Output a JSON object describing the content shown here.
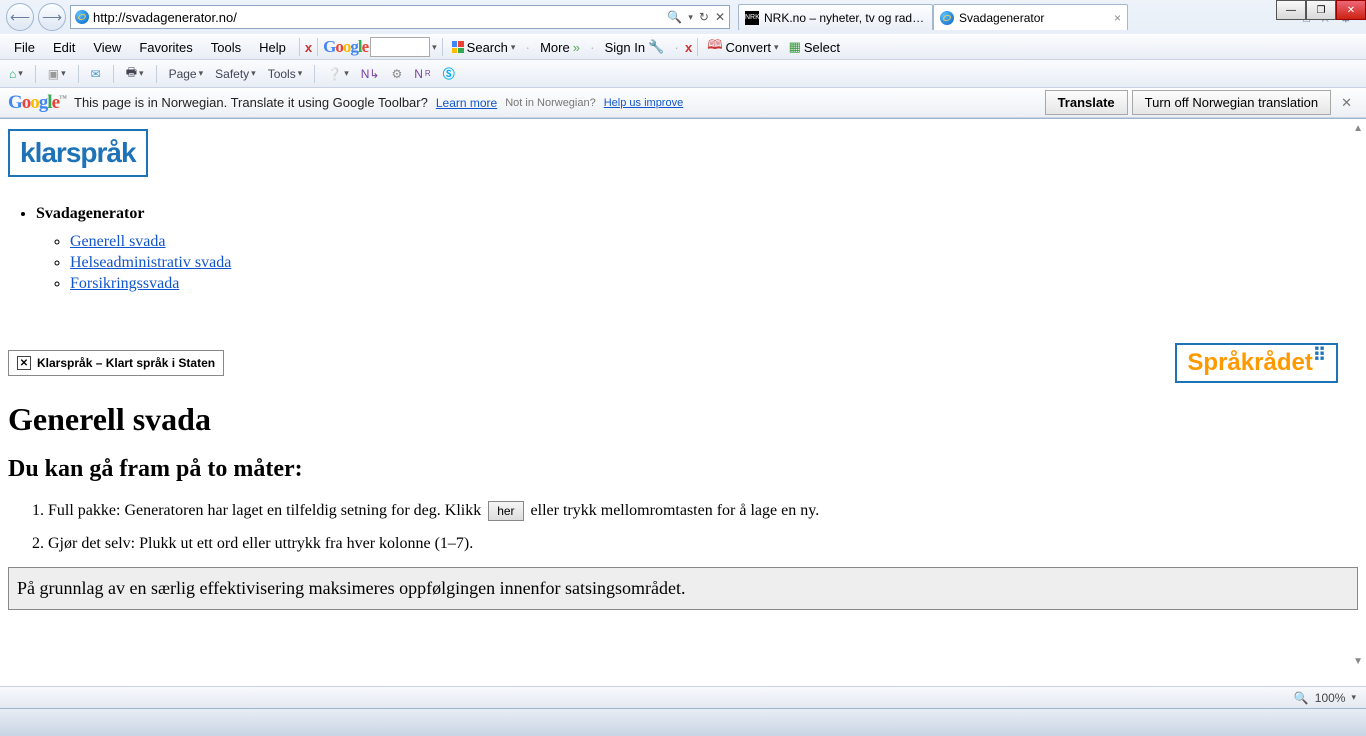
{
  "window_controls": {
    "min": "—",
    "max": "❐",
    "close": "✕"
  },
  "address_bar": {
    "url": "http://svadagenerator.no/"
  },
  "tabs": [
    {
      "title": "NRK.no – nyheter, tv og radio ...",
      "active": false
    },
    {
      "title": "Svadagenerator",
      "active": true
    }
  ],
  "chrome_icons": {
    "home": "⌂",
    "star": "☆",
    "gear": "⚙"
  },
  "menu": {
    "items": [
      "File",
      "Edit",
      "View",
      "Favorites",
      "Tools",
      "Help"
    ],
    "close_x": "x",
    "google": "Google",
    "search": "Search",
    "more": "More",
    "signin": "Sign In",
    "convert": "Convert",
    "select": "Select"
  },
  "cmdbar": {
    "page": "Page",
    "safety": "Safety",
    "tools": "Tools"
  },
  "translate_bar": {
    "brand": "Google",
    "msg": "This page is in Norwegian.  Translate it using Google Toolbar?",
    "learn": "Learn more",
    "not_in": "Not in Norwegian?",
    "help": "Help us improve",
    "btn_translate": "Translate",
    "btn_turnoff": "Turn off Norwegian translation"
  },
  "page": {
    "logo": "klarspråk",
    "nav_title": "Svadagenerator",
    "nav_links": [
      "Generell svada",
      "Helseadministrativ svada",
      "Forsikringssvada"
    ],
    "stamp": "Klarspråk – Klart språk i Staten",
    "sprakradet": "Språkrådet",
    "h1": "Generell svada",
    "h2": "Du kan gå fram på to måter:",
    "step1_a": "Full pakke: Generatoren har laget en tilfeldig setning for deg. Klikk ",
    "her": "her",
    "step1_b": " eller trykk mellomromtasten for å lage en ny.",
    "step2": "Gjør det selv: Plukk ut ett ord eller uttrykk fra hver kolonne (1–7).",
    "result": "På grunnlag av en særlig effektivisering maksimeres oppfølgingen innenfor satsingsområdet."
  },
  "status": {
    "zoom": "100%"
  }
}
